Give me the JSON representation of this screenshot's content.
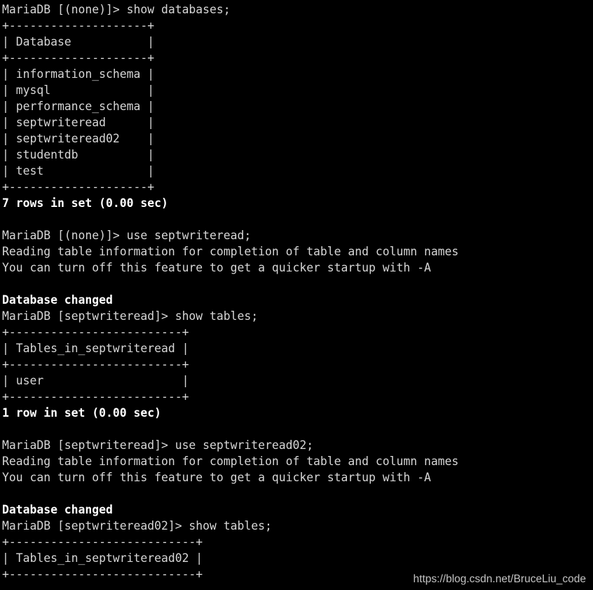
{
  "terminal": {
    "background_color": "#000000",
    "text_color": "#d6d6d6",
    "bold_text_color": "#ffffff",
    "lines": [
      {
        "text": "MariaDB [(none)]> show databases;",
        "bold": false
      },
      {
        "text": "+--------------------+",
        "bold": false
      },
      {
        "text": "| Database           |",
        "bold": false
      },
      {
        "text": "+--------------------+",
        "bold": false
      },
      {
        "text": "| information_schema |",
        "bold": false
      },
      {
        "text": "| mysql              |",
        "bold": false
      },
      {
        "text": "| performance_schema |",
        "bold": false
      },
      {
        "text": "| septwriteread      |",
        "bold": false
      },
      {
        "text": "| septwriteread02    |",
        "bold": false
      },
      {
        "text": "| studentdb          |",
        "bold": false
      },
      {
        "text": "| test               |",
        "bold": false
      },
      {
        "text": "+--------------------+",
        "bold": false
      },
      {
        "text": "7 rows in set (0.00 sec)",
        "bold": true
      },
      {
        "text": "",
        "bold": false
      },
      {
        "text": "MariaDB [(none)]> use septwriteread;",
        "bold": false
      },
      {
        "text": "Reading table information for completion of table and column names",
        "bold": false
      },
      {
        "text": "You can turn off this feature to get a quicker startup with -A",
        "bold": false
      },
      {
        "text": "",
        "bold": false
      },
      {
        "text": "Database changed",
        "bold": true
      },
      {
        "text": "MariaDB [septwriteread]> show tables;",
        "bold": false
      },
      {
        "text": "+-------------------------+",
        "bold": false
      },
      {
        "text": "| Tables_in_septwriteread |",
        "bold": false
      },
      {
        "text": "+-------------------------+",
        "bold": false
      },
      {
        "text": "| user                    |",
        "bold": false
      },
      {
        "text": "+-------------------------+",
        "bold": false
      },
      {
        "text": "1 row in set (0.00 sec)",
        "bold": true
      },
      {
        "text": "",
        "bold": false
      },
      {
        "text": "MariaDB [septwriteread]> use septwriteread02;",
        "bold": false
      },
      {
        "text": "Reading table information for completion of table and column names",
        "bold": false
      },
      {
        "text": "You can turn off this feature to get a quicker startup with -A",
        "bold": false
      },
      {
        "text": "",
        "bold": false
      },
      {
        "text": "Database changed",
        "bold": true
      },
      {
        "text": "MariaDB [septwriteread02]> show tables;",
        "bold": false
      },
      {
        "text": "+---------------------------+",
        "bold": false
      },
      {
        "text": "| Tables_in_septwriteread02 |",
        "bold": false
      },
      {
        "text": "+---------------------------+",
        "bold": false
      }
    ]
  },
  "watermarks": {
    "brand": "BRUCELIU",
    "brand_color": "#2b2b2b",
    "url": "https://blog.csdn.net/BruceLiu_code",
    "url_color": "#c2c2c2"
  }
}
